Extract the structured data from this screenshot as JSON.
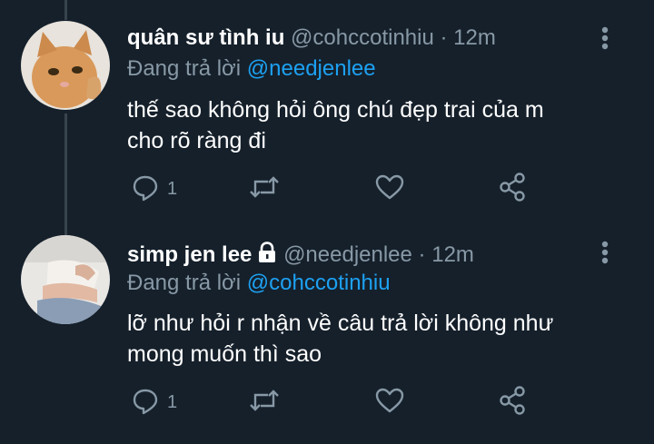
{
  "tweets": [
    {
      "display_name": "quân sư tình iu",
      "handle": "@cohccotinhiu",
      "separator": "·",
      "time": "12m",
      "reply_prefix": "Đang trả lời",
      "reply_to": "@needjenlee",
      "text_lines": [
        "thế sao không hỏi ông chú đẹp trai của m",
        "cho rõ ràng đi"
      ],
      "reply_count": "1",
      "locked": false
    },
    {
      "display_name": "simp jen lee",
      "handle": "@needjenlee",
      "separator": "·",
      "time": "12m",
      "reply_prefix": "Đang trả lời",
      "reply_to": "@cohccotinhiu",
      "text_lines": [
        "lỡ như hỏi r nhận về câu trả lời không như",
        "mong muốn thì sao"
      ],
      "reply_count": "1",
      "locked": true
    }
  ],
  "icons": {
    "reply": "comment-icon",
    "retweet": "retweet-icon",
    "like": "heart-icon",
    "share": "share-icon",
    "more": "more-vertical-icon",
    "lock": "lock-icon"
  },
  "colors": {
    "background": "#15202b",
    "secondary_text": "#8899a6",
    "accent": "#1da1f2",
    "thread_line": "#38444d"
  }
}
